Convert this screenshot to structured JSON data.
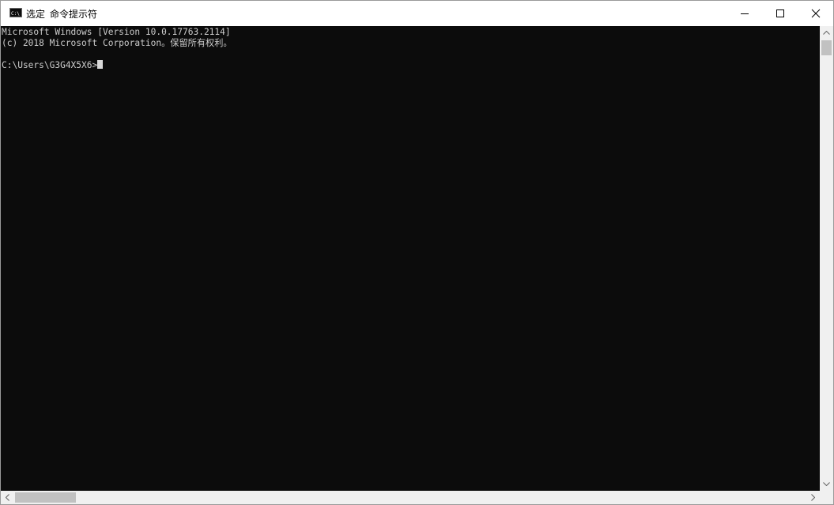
{
  "window": {
    "title_prefix": "选定",
    "title": "命令提示符",
    "icon": "console-app-icon"
  },
  "caption_buttons": {
    "minimize": "minimize-icon",
    "maximize": "maximize-icon",
    "close": "close-icon"
  },
  "console": {
    "lines": [
      "Microsoft Windows [Version 10.0.17763.2114]",
      "(c) 2018 Microsoft Corporation。保留所有权利。",
      "",
      "C:\\Users\\G3G4X5X6>"
    ],
    "background": "#0c0c0c",
    "foreground": "#cccccc"
  },
  "scrollbars": {
    "vertical": {
      "up": "chevron-up-icon",
      "down": "chevron-down-icon"
    },
    "horizontal": {
      "left": "chevron-left-icon",
      "right": "chevron-right-icon"
    }
  }
}
